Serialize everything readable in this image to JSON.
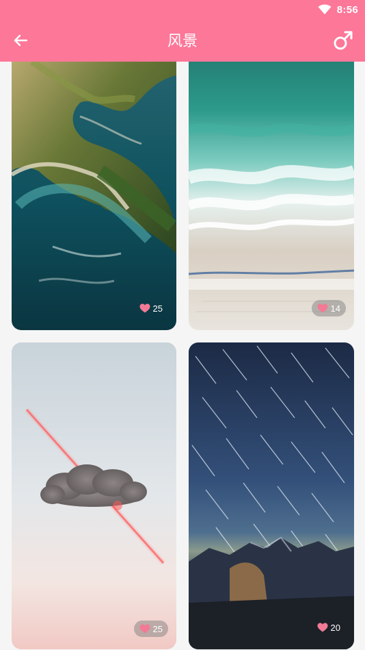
{
  "status_bar": {
    "time": "8:56",
    "icons": [
      "wifi-icon"
    ]
  },
  "app_bar": {
    "title": "风景",
    "left_icon": "back-arrow-icon",
    "right_icon": "male-symbol-icon"
  },
  "colors": {
    "accent": "#fd7799",
    "heart": "#f27a95",
    "background": "#f5f5f5"
  },
  "cards": [
    {
      "scene": "aerial-coastline-cliffs",
      "likes": "25"
    },
    {
      "scene": "aerial-beach-waves",
      "likes": "14"
    },
    {
      "scene": "cloud-with-red-laser",
      "likes": "25"
    },
    {
      "scene": "star-trails-over-mountains",
      "likes": "20"
    }
  ]
}
